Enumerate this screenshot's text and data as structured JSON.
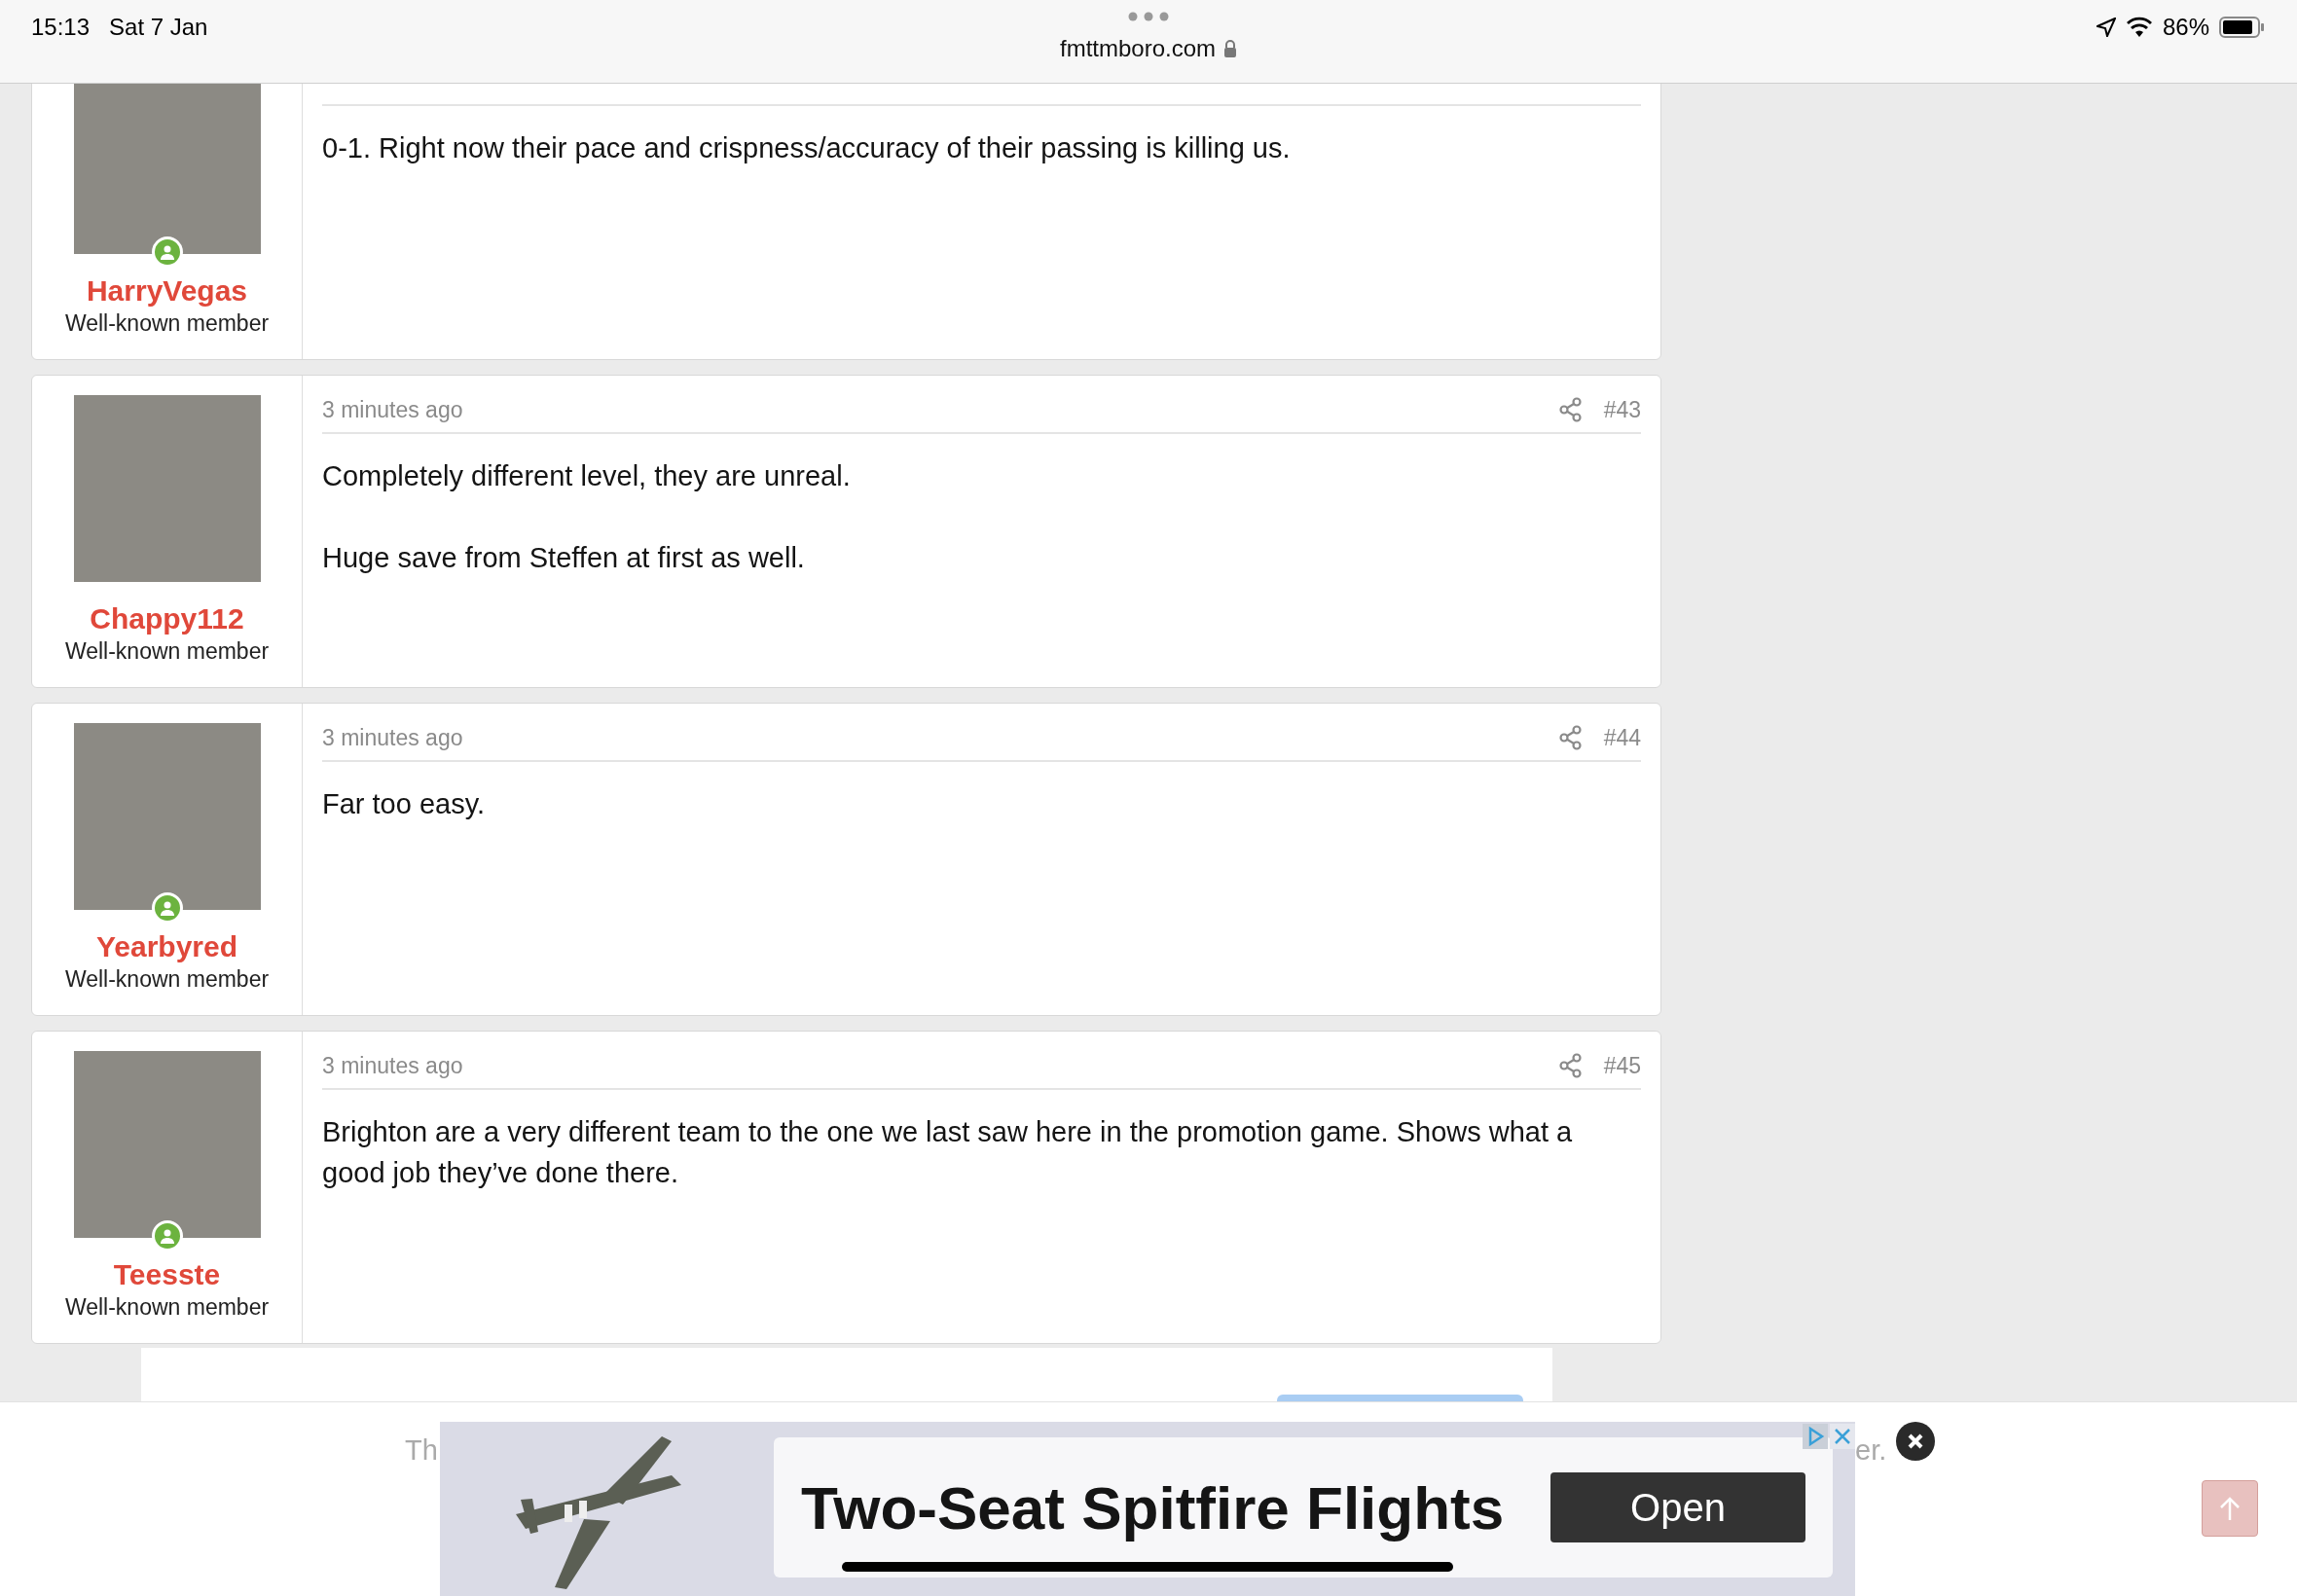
{
  "status_bar": {
    "time": "15:13",
    "date": "Sat 7 Jan",
    "battery": "86%",
    "url": "fmttmboro.com"
  },
  "posts": [
    {
      "author": "HarryVegas",
      "role": "Well-known member",
      "online": true,
      "paragraphs": [
        "0-1. Right now their pace and crispness/accuracy of their passing is killing us."
      ]
    },
    {
      "author": "Chappy112",
      "role": "Well-known member",
      "online": false,
      "time": "3 minutes ago",
      "number": "#43",
      "paragraphs": [
        "Completely different level, they are unreal.",
        "Huge save from Steffen at first as well."
      ]
    },
    {
      "author": "Yearbyred",
      "role": "Well-known member",
      "online": true,
      "time": "3 minutes ago",
      "number": "#44",
      "paragraphs": [
        "Far too easy."
      ]
    },
    {
      "author": "Teesste",
      "role": "Well-known member",
      "online": true,
      "time": "3 minutes ago",
      "number": "#45",
      "paragraphs": [
        "Brighton are a very different team to the one we last saw here in the promotion game. Shows what a good job they’ve done there."
      ]
    }
  ],
  "notice": {
    "left_fragment": "Th",
    "right_fragment": "er."
  },
  "ad": {
    "headline": "Two-Seat Spitfire Flights",
    "button": "Open"
  }
}
